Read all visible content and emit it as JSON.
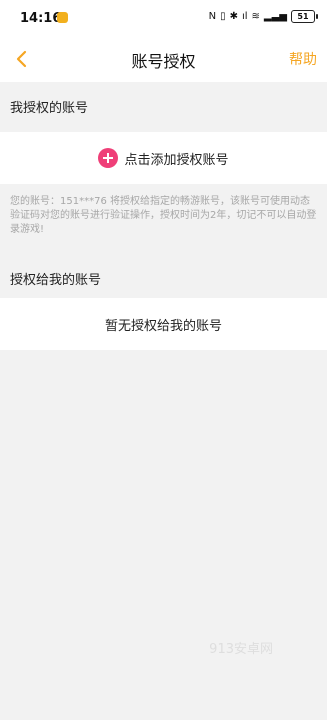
{
  "status_bar": {
    "time": "14:16",
    "battery_level": "51",
    "icons": [
      "nfc-icon",
      "vibrate-icon",
      "bluetooth-icon",
      "signal-icon",
      "wifi-icon",
      "signal-bars-icon",
      "battery-icon"
    ]
  },
  "header": {
    "title": "账号授权",
    "help_label": "帮助"
  },
  "section_my_authorized": {
    "title": "我授权的账号",
    "add_label": "点击添加授权账号",
    "note": "您的账号：151***76 将授权给指定的畅游账号，该账号可使用动态验证码对您的账号进行验证操作，授权时间为2年，切记不可以自动登录游戏!"
  },
  "section_authorized_to_me": {
    "title": "授权给我的账号",
    "empty_text": "暂无授权给我的账号"
  },
  "watermark": "913安卓网",
  "colors": {
    "accent": "#f5a623",
    "add_button": "#ef3f78",
    "background": "#f2f2f2"
  }
}
